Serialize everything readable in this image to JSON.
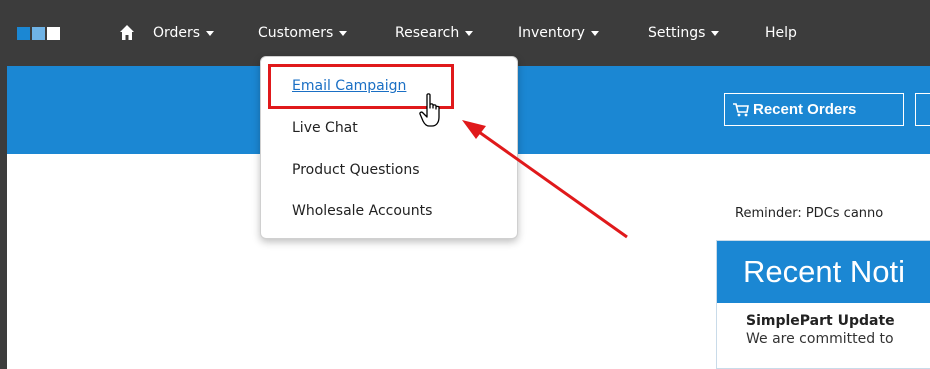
{
  "nav": {
    "items": [
      {
        "label": "Orders",
        "has_caret": true
      },
      {
        "label": "Customers",
        "has_caret": true
      },
      {
        "label": "Research",
        "has_caret": true
      },
      {
        "label": "Inventory",
        "has_caret": true
      },
      {
        "label": "Settings",
        "has_caret": true
      },
      {
        "label": "Help",
        "has_caret": false
      }
    ],
    "home_icon": "home-icon",
    "logo_icon": "logo-squares-icon",
    "colors": {
      "nav_bg": "#3c3c3c",
      "nav_text": "#ffffff"
    }
  },
  "header": {
    "recent_orders_label": "Recent Orders",
    "cart_icon": "cart-icon",
    "bar_color": "#1b87d3"
  },
  "customers_menu": {
    "items": [
      {
        "label": "Email Campaign",
        "is_link": true
      },
      {
        "label": "Live Chat",
        "is_link": false
      },
      {
        "label": "Product Questions",
        "is_link": false
      },
      {
        "label": "Wholesale Accounts",
        "is_link": false
      }
    ],
    "highlight_color": "#e0191b"
  },
  "main": {
    "reminder": "Reminder: PDCs canno",
    "notifications": {
      "header": "Recent Noti",
      "item_title": "SimplePart Update",
      "item_text": "We are committed to"
    }
  },
  "annotation": {
    "arrow_icon": "red-arrow-icon",
    "cursor_icon": "hand-cursor-icon"
  }
}
